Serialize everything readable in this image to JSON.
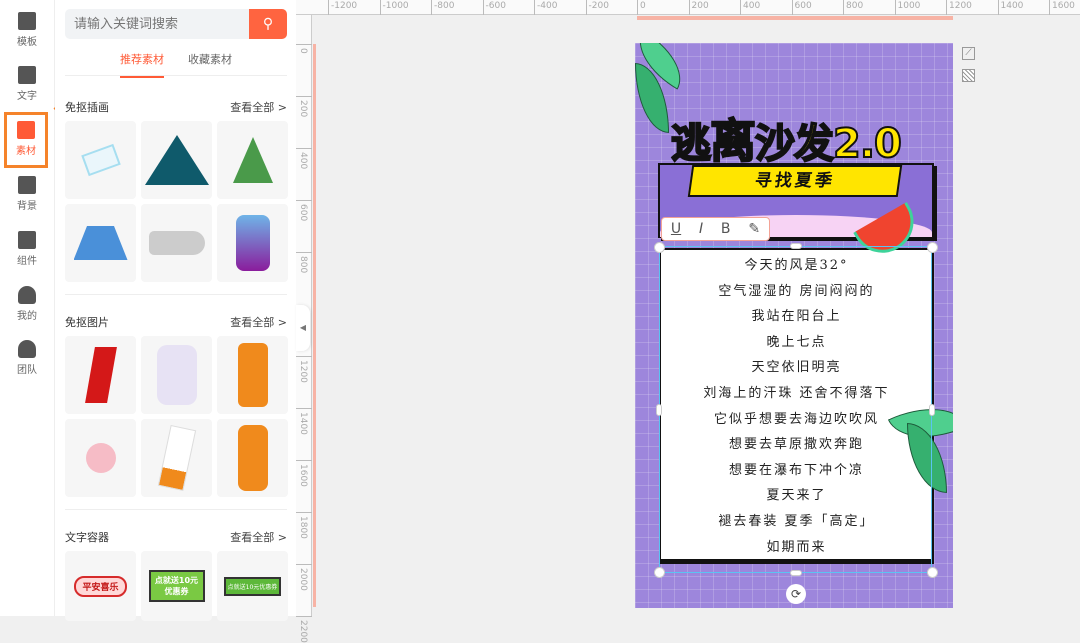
{
  "sidebar": {
    "items": [
      {
        "label": "模板",
        "icon": "template-icon"
      },
      {
        "label": "文字",
        "icon": "text-icon"
      },
      {
        "label": "素材",
        "icon": "image-plus-icon",
        "active": true
      },
      {
        "label": "背景",
        "icon": "background-icon"
      },
      {
        "label": "组件",
        "icon": "component-icon"
      },
      {
        "label": "我的",
        "icon": "user-icon"
      },
      {
        "label": "团队",
        "icon": "team-icon"
      }
    ]
  },
  "panel": {
    "search_placeholder": "请输入关键词搜索",
    "tabs": [
      "推荐素材",
      "收藏素材"
    ],
    "sections": [
      {
        "title": "免抠插画",
        "more": "查看全部 >"
      },
      {
        "title": "免抠图片",
        "more": "查看全部 >"
      },
      {
        "title": "文字容器",
        "more": "查看全部 >"
      }
    ],
    "containers": [
      "平安喜乐",
      "点就送10元 优惠券",
      "点就送10元优惠券"
    ]
  },
  "ruler": {
    "h_labels": [
      "-1200",
      "-1000",
      "-800",
      "-600",
      "-400",
      "-200",
      "0",
      "200",
      "400",
      "600",
      "800",
      "1000",
      "1200",
      "1400",
      "1600"
    ],
    "v_labels": [
      "0",
      "200",
      "400",
      "600",
      "800",
      "1000",
      "1200",
      "1400",
      "1600",
      "1800",
      "2000",
      "2200"
    ]
  },
  "poster": {
    "title_a": "逃",
    "title_b": "离",
    "title_c": "沙发2.0",
    "subtitle": "寻找夏季",
    "poem": [
      "今天的风是32°",
      "空气湿湿的 房间闷闷的",
      "我站在阳台上",
      "晚上七点",
      "天空依旧明亮",
      "刘海上的汗珠 还舍不得落下",
      "它似乎想要去海边吹吹风",
      "想要去草原撒欢奔跑",
      "想要在瀑布下冲个凉",
      "夏天来了",
      "褪去春装 夏季「高定」",
      "如期而来"
    ]
  },
  "format_toolbar": {
    "underline": "U",
    "italic": "I",
    "bold": "B",
    "pen": "✎"
  },
  "colors": {
    "accent": "#ff5a36",
    "highlight": "#f5832a",
    "canvas": "#9d86dc"
  }
}
